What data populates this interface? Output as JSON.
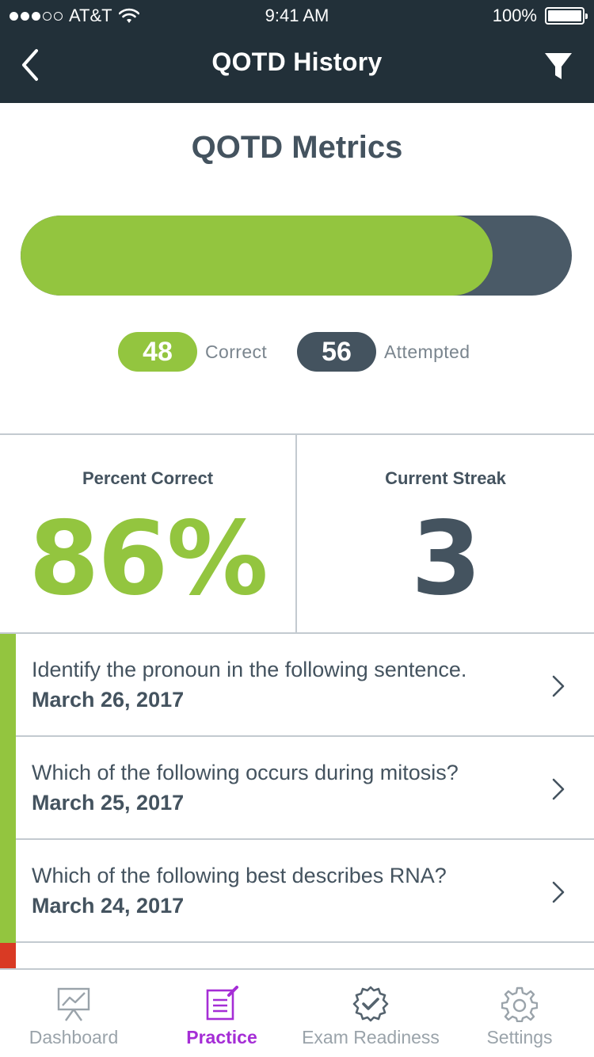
{
  "status_bar": {
    "signal_dots": [
      true,
      true,
      true,
      false,
      false
    ],
    "carrier": "AT&T",
    "time": "9:41 AM",
    "battery_percent": "100%"
  },
  "nav": {
    "title": "QOTD History",
    "back_icon": "chevron-left-icon",
    "filter_icon": "filter-icon"
  },
  "metrics": {
    "title": "QOTD Metrics",
    "progress_fraction": 0.857,
    "correct_count": "48",
    "correct_label": "Correct",
    "attempted_count": "56",
    "attempted_label": "Attempted",
    "colors": {
      "correct": "#93c53f",
      "attempted": "#4a5a67",
      "incorrect": "#d93a24"
    }
  },
  "stats": {
    "percent_correct_label": "Percent Correct",
    "percent_correct_value": "86%",
    "current_streak_label": "Current Streak",
    "current_streak_value": "3"
  },
  "questions": [
    {
      "text": "Identify the pronoun in the following sentence.",
      "date": "March 26, 2017",
      "status": "correct"
    },
    {
      "text": "Which of the following occurs during mitosis?",
      "date": "March 25, 2017",
      "status": "correct"
    },
    {
      "text": "Which of the following best describes RNA?",
      "date": "March 24, 2017",
      "status": "correct"
    },
    {
      "text": "",
      "date": "",
      "status": "incorrect"
    }
  ],
  "tabs": [
    {
      "label": "Dashboard",
      "icon": "dashboard-chart-icon",
      "active": false
    },
    {
      "label": "Practice",
      "icon": "practice-notepad-icon",
      "active": true
    },
    {
      "label": "Exam Readiness",
      "icon": "exam-readiness-badge-icon",
      "active": false
    },
    {
      "label": "Settings",
      "icon": "gear-icon",
      "active": false
    }
  ]
}
